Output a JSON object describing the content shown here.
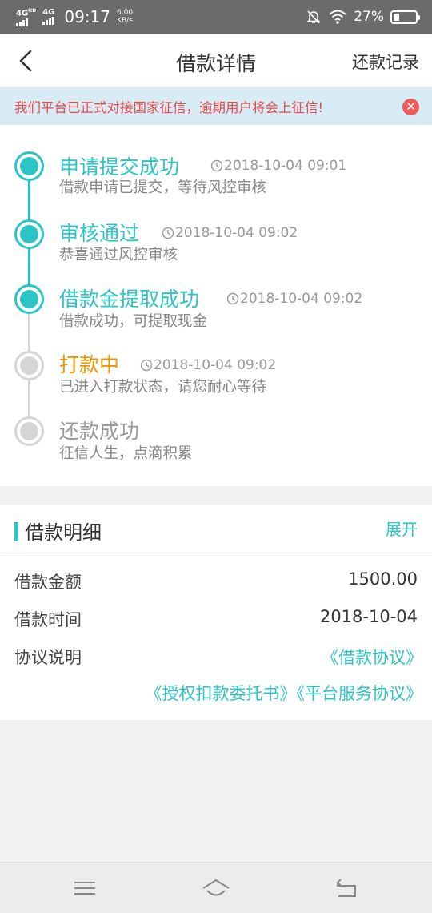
{
  "status_bar": {
    "net1": "4G",
    "net1_suffix": "HD",
    "net2": "4G",
    "time": "09:17",
    "speed_value": "6.00",
    "speed_unit": "KB/s",
    "battery_pct": "27%",
    "battery_level": 0.27
  },
  "header": {
    "title": "借款详情",
    "records_link": "还款记录"
  },
  "notice": {
    "text": "我们平台已正式对接国家征信，逾期用户将会上征信!"
  },
  "timeline": [
    {
      "title": "申请提交成功",
      "time": "2018-10-04 09:01",
      "desc": "借款申请已提交，等待风控审核",
      "status": "done"
    },
    {
      "title": "审核通过",
      "time": "2018-10-04 09:02",
      "desc": "恭喜通过风控审核",
      "status": "done"
    },
    {
      "title": "借款金提取成功",
      "time": "2018-10-04 09:02",
      "desc": "借款成功，可提取现金",
      "status": "done"
    },
    {
      "title": "打款中",
      "time": "2018-10-04 09:02",
      "desc": "已进入打款状态，请您耐心等待",
      "status": "current"
    },
    {
      "title": "还款成功",
      "time": "",
      "desc": "征信人生，点滴积累",
      "status": "pending"
    }
  ],
  "details": {
    "section_title": "借款明细",
    "expand_label": "展开",
    "amount_label": "借款金额",
    "amount_value": "1500.00",
    "date_label": "借款时间",
    "date_value": "2018-10-04",
    "agreement_label": "协议说明",
    "agreement_links": [
      "《借款协议》",
      "《授权扣款委托书》",
      "《平台服务协议》"
    ]
  },
  "colors": {
    "accent": "#2cc5c5",
    "in_progress": "#f29400",
    "pending": "#d6d6d6",
    "notice_bg": "#d8ecf6",
    "notice_text": "#e84a4a"
  }
}
